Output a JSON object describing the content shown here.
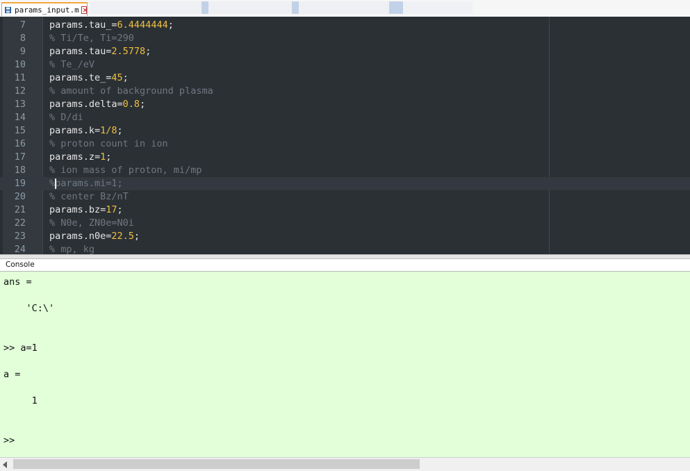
{
  "tab": {
    "title": "params_input.m"
  },
  "editor": {
    "lines": [
      {
        "n": "7",
        "parts": [
          {
            "t": "params.tau_=",
            "k": "code"
          },
          {
            "t": "6.4444444",
            "k": "num"
          },
          {
            "t": ";",
            "k": "code"
          }
        ]
      },
      {
        "n": "8",
        "comment": "% Ti/Te, Ti=290"
      },
      {
        "n": "9",
        "parts": [
          {
            "t": "params.tau=",
            "k": "code"
          },
          {
            "t": "2.5778",
            "k": "num"
          },
          {
            "t": ";",
            "k": "code"
          }
        ]
      },
      {
        "n": "10",
        "comment": "% Te_/eV"
      },
      {
        "n": "11",
        "parts": [
          {
            "t": "params.te_=",
            "k": "code"
          },
          {
            "t": "45",
            "k": "num"
          },
          {
            "t": ";",
            "k": "code"
          }
        ]
      },
      {
        "n": "12",
        "comment": "% amount of background plasma"
      },
      {
        "n": "13",
        "parts": [
          {
            "t": "params.delta=",
            "k": "code"
          },
          {
            "t": "0.8",
            "k": "num"
          },
          {
            "t": ";",
            "k": "code"
          }
        ]
      },
      {
        "n": "14",
        "comment": "% D/di"
      },
      {
        "n": "15",
        "parts": [
          {
            "t": "params.k=",
            "k": "code"
          },
          {
            "t": "1/8",
            "k": "num"
          },
          {
            "t": ";",
            "k": "code"
          }
        ]
      },
      {
        "n": "16",
        "comment": "% proton count in ion"
      },
      {
        "n": "17",
        "parts": [
          {
            "t": "params.z=",
            "k": "code"
          },
          {
            "t": "1",
            "k": "num"
          },
          {
            "t": ";",
            "k": "code"
          }
        ]
      },
      {
        "n": "18",
        "comment": "% ion mass of proton, mi/mp"
      },
      {
        "n": "19",
        "comment": "%params.mi=1;",
        "current": true
      },
      {
        "n": "20",
        "comment": "% center Bz/nT"
      },
      {
        "n": "21",
        "parts": [
          {
            "t": "params.bz=",
            "k": "code"
          },
          {
            "t": "17",
            "k": "num"
          },
          {
            "t": ";",
            "k": "code"
          }
        ]
      },
      {
        "n": "22",
        "comment": "% N0e, ZN0e=N0i"
      },
      {
        "n": "23",
        "parts": [
          {
            "t": "params.n0e=",
            "k": "code"
          },
          {
            "t": "22.5",
            "k": "num"
          },
          {
            "t": ";",
            "k": "code"
          }
        ]
      },
      {
        "n": "24",
        "comment": "% mp, kg"
      }
    ]
  },
  "console": {
    "title": "Console",
    "lines": [
      "ans =",
      "",
      "    'C:\\'",
      "",
      "",
      ">> a=1",
      "",
      "a =",
      "",
      "     1",
      "",
      "",
      ">>"
    ]
  }
}
